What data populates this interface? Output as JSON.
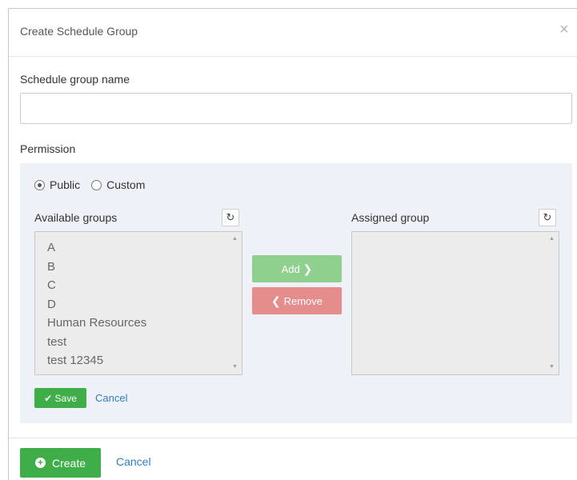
{
  "dialog": {
    "title": "Create Schedule Group",
    "close_symbol": "×"
  },
  "form": {
    "name_label": "Schedule group name",
    "name_value": "",
    "name_placeholder": "",
    "permission_label": "Permission"
  },
  "permission": {
    "options": [
      {
        "label": "Public",
        "selected": true
      },
      {
        "label": "Custom",
        "selected": false
      }
    ],
    "available_label": "Available groups",
    "assigned_label": "Assigned group",
    "available_groups": [
      "A",
      "B",
      "C",
      "D",
      "Human Resources",
      "test",
      "test 12345"
    ],
    "assigned_groups": [],
    "add_label": "Add",
    "add_icon": "chevron-right-icon",
    "remove_label": "Remove",
    "remove_icon": "chevron-left-icon",
    "refresh_icon": "refresh-icon",
    "save_label": "Save",
    "save_icon": "check-icon",
    "cancel_label": "Cancel"
  },
  "footer": {
    "create_label": "Create",
    "create_icon": "plus-circle-icon",
    "cancel_label": "Cancel"
  },
  "colors": {
    "primary_green": "#3fae49",
    "add_green": "#8fd08f",
    "remove_red": "#e58c8c",
    "link_blue": "#2d7fc0",
    "panel_bg": "#eef1f7"
  }
}
